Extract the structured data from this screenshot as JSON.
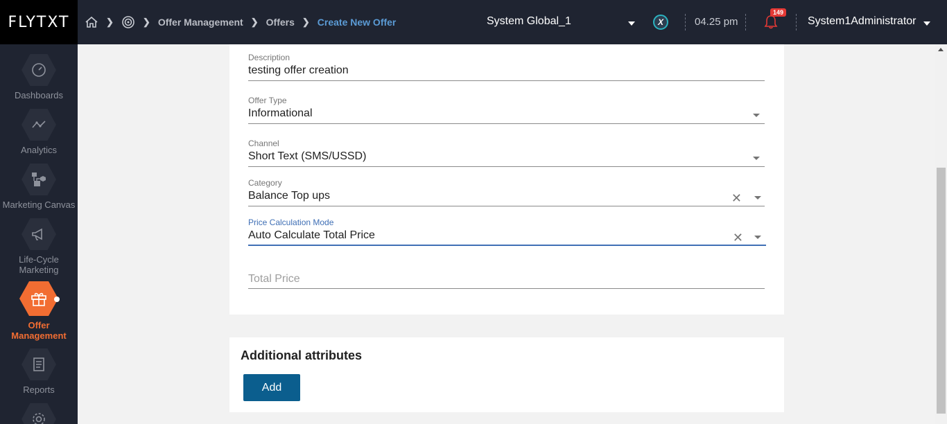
{
  "app": {
    "logo": "FLYTXT"
  },
  "breadcrumb": {
    "items": [
      "Offer Management",
      "Offers",
      "Create New Offer"
    ]
  },
  "header": {
    "system_select": "System Global_1",
    "time": "04.25 pm",
    "notification_count": "149",
    "user_name": "System1Administrator",
    "x_badge": "X"
  },
  "sidebar": {
    "items": [
      {
        "label": "Dashboards",
        "icon": "gauge-icon"
      },
      {
        "label": "Analytics",
        "icon": "analytics-icon"
      },
      {
        "label": "Marketing Canvas",
        "icon": "canvas-icon"
      },
      {
        "label": "Life-Cycle Marketing",
        "icon": "megaphone-icon"
      },
      {
        "label": "Offer Management",
        "icon": "gift-icon",
        "active": true
      },
      {
        "label": "Reports",
        "icon": "report-icon"
      },
      {
        "label": "",
        "icon": "gear-icon"
      }
    ]
  },
  "form": {
    "description": {
      "label": "Description",
      "value": "testing offer creation"
    },
    "offer_type": {
      "label": "Offer Type",
      "value": "Informational"
    },
    "channel": {
      "label": "Channel",
      "value": "Short Text (SMS/USSD)"
    },
    "category": {
      "label": "Category",
      "value": "Balance Top ups"
    },
    "price_mode": {
      "label": "Price Calculation Mode",
      "value": "Auto Calculate Total Price"
    },
    "total_price": {
      "placeholder": "Total Price"
    }
  },
  "additional": {
    "title": "Additional attributes",
    "add_label": "Add"
  },
  "colors": {
    "accent": "#f26d32",
    "header_bg": "#1f2431",
    "focus": "#3f6fb5",
    "button": "#0b5e8e"
  }
}
